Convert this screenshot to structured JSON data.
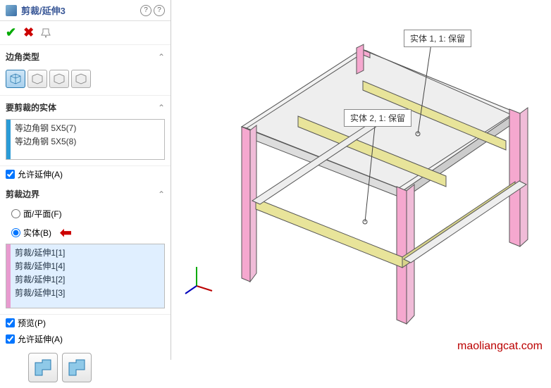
{
  "header": {
    "title": "剪裁/延伸3"
  },
  "sections": {
    "corner_type": {
      "title": "边角类型"
    },
    "bodies_to_trim": {
      "title": "要剪裁的实体",
      "items": [
        "等边角钢 5X5(7)",
        "等边角钢 5X5(8)"
      ]
    },
    "allow_extend_a": {
      "label": "允许延伸(A)",
      "checked": true
    },
    "trim_boundary": {
      "title": "剪裁边界",
      "radio_face": {
        "label": "面/平面(F)",
        "checked": false
      },
      "radio_body": {
        "label": "实体(B)",
        "checked": true
      },
      "items": [
        "剪裁/延伸1[1]",
        "剪裁/延伸1[4]",
        "剪裁/延伸1[2]",
        "剪裁/延伸1[3]"
      ]
    },
    "preview": {
      "label": "预览(P)",
      "checked": true
    },
    "allow_extend_a2": {
      "label": "允许延伸(A)",
      "checked": true
    }
  },
  "callouts": {
    "c1": "实体 1, 1: 保留",
    "c2": "实体 2, 1: 保留"
  },
  "watermark": "maoliangcat.com",
  "colors": {
    "pink": "#f5a8cf",
    "yellow": "#e8e49a",
    "gray": "#d8d8d8",
    "edge": "#555"
  }
}
